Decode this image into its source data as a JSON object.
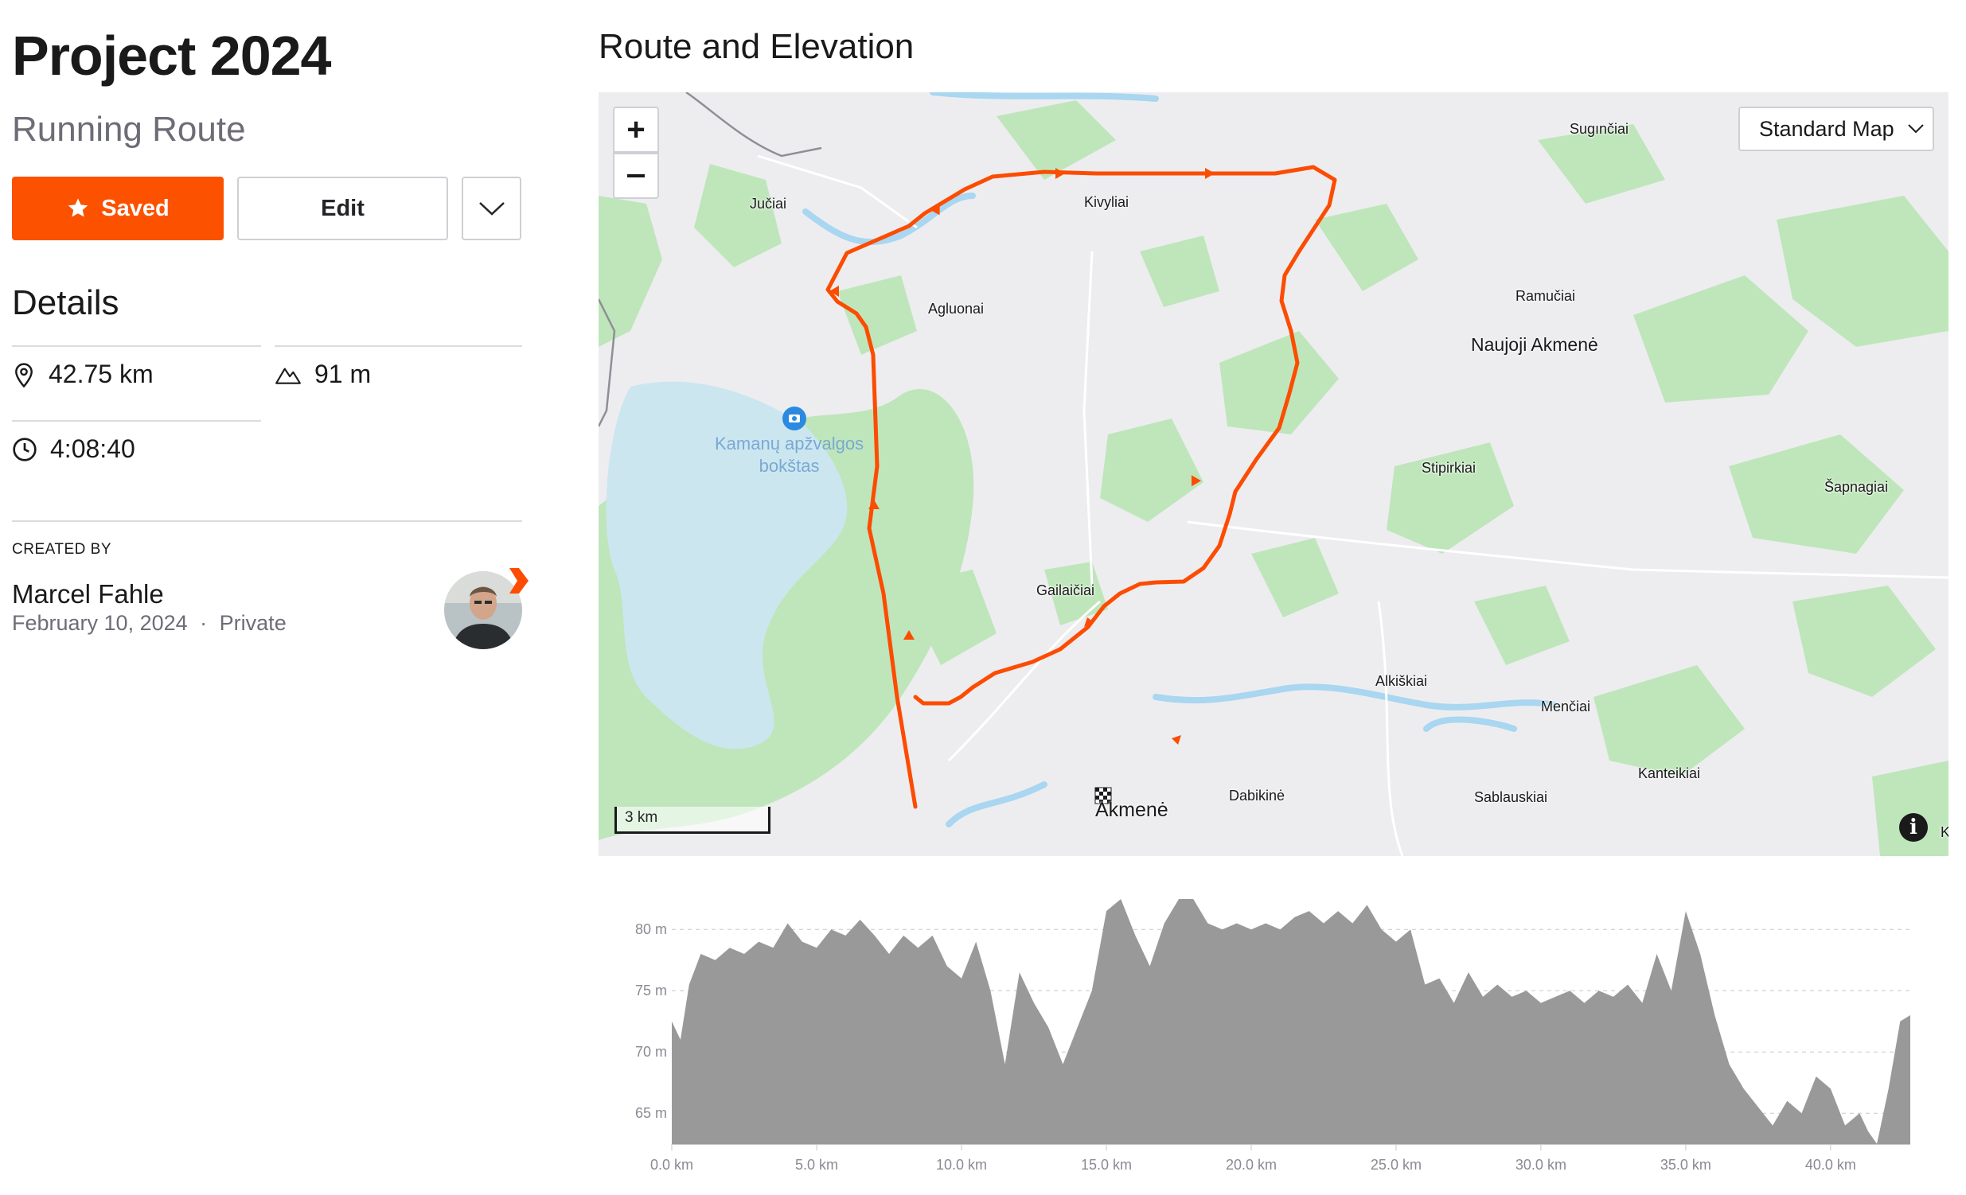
{
  "route": {
    "title": "Project 2024",
    "subtitle": "Running Route",
    "actions": {
      "saved_label": "Saved",
      "edit_label": "Edit"
    }
  },
  "details": {
    "heading": "Details",
    "distance": "42.75 km",
    "elevation_gain": "91 m",
    "duration": "4:08:40"
  },
  "creator": {
    "label": "CREATED BY",
    "name": "Marcel Fahle",
    "date": "February 10, 2024",
    "separator": "·",
    "visibility": "Private"
  },
  "map": {
    "section_title": "Route and Elevation",
    "style_label": "Standard Map",
    "scale_label": "3 km",
    "info_label": "i",
    "places": {
      "juciai": "Jučiai",
      "kivyliai": "Kivyliai",
      "sugınciai": "Sugınčiai",
      "agluonai": "Agluonai",
      "ramuciai": "Ramučiai",
      "naujoji": "Naujoji Akmenė",
      "stipirkiai": "Stipirkiai",
      "sapnagiai": "Šapnagiai",
      "gailaiciai": "Gailaičiai",
      "alkiskiai": "Alkiškiai",
      "menciai": "Menčiai",
      "kanteikiai": "Kanteikiai",
      "dabikine": "Dabikinė",
      "sablauskiai": "Sablauskiai",
      "akmene": "Akmenė",
      "edge_k": "K"
    },
    "poi": {
      "line1": "Kamanų apžvalgos",
      "line2": "bokštas"
    },
    "colors": {
      "route": "#fc4c02",
      "forest": "#bfe6bb",
      "water": "#a9d6f0",
      "lake": "#cce6f0",
      "land": "#ededf0"
    }
  },
  "chart_data": {
    "type": "area",
    "title": "",
    "xlabel": "",
    "ylabel": "",
    "x_unit": "km",
    "y_unit": "m",
    "xlim": [
      0,
      42.75
    ],
    "ylim": [
      63,
      80
    ],
    "x_ticks": [
      "0.0 km",
      "5.0 km",
      "10.0 km",
      "15.0 km",
      "20.0 km",
      "25.0 km",
      "30.0 km",
      "35.0 km",
      "40.0 km"
    ],
    "y_ticks": [
      "80 m",
      "75 m",
      "70 m",
      "65 m"
    ],
    "y_tick_values": [
      80,
      75,
      70,
      65
    ],
    "grid": true,
    "color": "#999999",
    "series": [
      {
        "x": [
          0,
          0.3,
          0.6,
          1.0,
          1.5,
          2.0,
          2.5,
          3.0,
          3.5,
          4.0,
          4.5,
          5.0,
          5.5,
          6.0,
          6.5,
          7.0,
          7.5,
          8.0,
          8.5,
          9.0,
          9.5,
          10.0,
          10.5,
          11.0,
          11.5,
          12.0,
          12.5,
          13.0,
          13.5,
          14.0,
          14.5,
          15.0,
          15.5,
          16.0,
          16.5,
          17.0,
          17.5,
          18.0,
          18.5,
          19.0,
          19.5,
          20.0,
          20.5,
          21.0,
          21.5,
          22.0,
          22.5,
          23.0,
          23.5,
          24.0,
          24.5,
          25.0,
          25.5,
          26.0,
          26.5,
          27.0,
          27.5,
          28.0,
          28.5,
          29.0,
          29.5,
          30.0,
          30.5,
          31.0,
          31.5,
          32.0,
          32.5,
          33.0,
          33.5,
          34.0,
          34.5,
          35.0,
          35.5,
          36.0,
          36.5,
          37.0,
          37.5,
          38.0,
          38.5,
          39.0,
          39.5,
          40.0,
          40.5,
          41.0,
          41.3,
          41.6,
          42.0,
          42.4,
          42.75
        ],
        "y": [
          72.5,
          71.0,
          75.5,
          78.0,
          77.5,
          78.5,
          78.0,
          79.0,
          78.5,
          80.5,
          79.0,
          78.5,
          80.0,
          79.5,
          80.8,
          79.5,
          78.0,
          79.5,
          78.5,
          79.5,
          77.0,
          76.0,
          79.0,
          75.0,
          69.0,
          76.5,
          74.0,
          72.0,
          69.0,
          72.0,
          75.0,
          81.5,
          82.5,
          79.5,
          77.0,
          80.5,
          83.0,
          82.5,
          80.5,
          80.0,
          80.5,
          80.0,
          80.5,
          80.0,
          81.0,
          81.5,
          80.5,
          81.5,
          80.5,
          82.0,
          80.0,
          79.0,
          80.0,
          75.5,
          76.0,
          74.0,
          76.5,
          74.5,
          75.5,
          74.5,
          75.0,
          74.0,
          74.5,
          75.0,
          74.0,
          75.0,
          74.5,
          75.5,
          74.0,
          78.0,
          75.0,
          81.5,
          78.0,
          73.0,
          69.0,
          67.0,
          65.5,
          64.0,
          66.0,
          65.0,
          68.0,
          67.0,
          64.0,
          65.0,
          63.5,
          62.5,
          67.0,
          72.5,
          73.0
        ]
      }
    ]
  }
}
